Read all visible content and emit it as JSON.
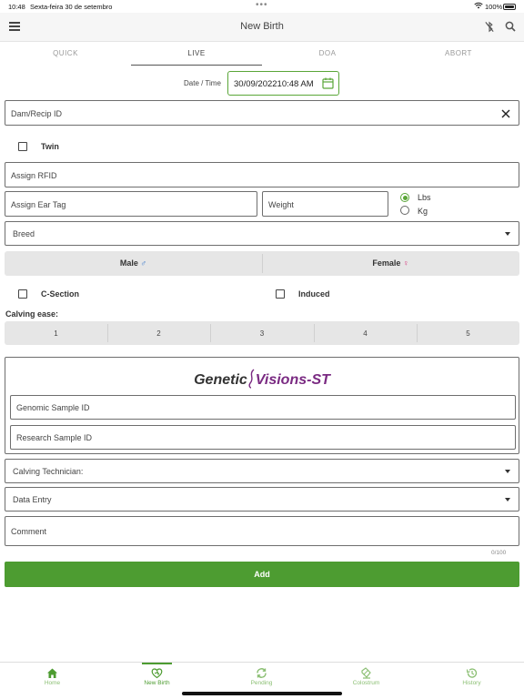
{
  "status_bar": {
    "time": "10:48",
    "date": "Sexta-feira 30 de setembro",
    "dots": "•••",
    "battery": "100%"
  },
  "header": {
    "title": "New Birth",
    "icons": [
      "menu-icon",
      "bluetooth-off-icon",
      "search-icon"
    ]
  },
  "tabs": [
    {
      "label": "QUICK",
      "active": false
    },
    {
      "label": "LIVE",
      "active": true
    },
    {
      "label": "DOA",
      "active": false
    },
    {
      "label": "ABORT",
      "active": false
    }
  ],
  "date_time": {
    "label": "Date / Time",
    "value": "30/09/202210:48 AM"
  },
  "fields": {
    "dam_recip_id": "Dam/Recip ID",
    "assign_rfid": "Assign RFID",
    "assign_ear_tag": "Assign Ear Tag",
    "weight": "Weight",
    "breed": "Breed",
    "genomic_sample_id": "Genomic Sample ID",
    "research_sample_id": "Research Sample ID",
    "calving_technician": "Calving Technician:",
    "data_entry": "Data Entry",
    "comment": "Comment"
  },
  "twin": {
    "label": "Twin",
    "checked": false
  },
  "weight_units": {
    "options": [
      "Lbs",
      "Kg"
    ],
    "selected": "Lbs"
  },
  "sex": {
    "male": "Male",
    "male_symbol": "♂",
    "female": "Female",
    "female_symbol": "♀"
  },
  "options": {
    "c_section": {
      "label": "C-Section",
      "checked": false
    },
    "induced": {
      "label": "Induced",
      "checked": false
    }
  },
  "calving_ease": {
    "label": "Calving ease:",
    "values": [
      "1",
      "2",
      "3",
      "4",
      "5"
    ]
  },
  "genetic_visions": {
    "logo_text_1": "Genetic",
    "logo_text_2": "Visions-ST"
  },
  "comment_counter": "0/100",
  "add_button": "Add",
  "bottom_nav": [
    {
      "label": "Home",
      "icon": "home-icon",
      "active": false
    },
    {
      "label": "New Birth",
      "icon": "new-birth-icon",
      "active": true
    },
    {
      "label": "Pending",
      "icon": "sync-icon",
      "active": false
    },
    {
      "label": "Colostrum",
      "icon": "colostrum-icon",
      "active": false
    },
    {
      "label": "History",
      "icon": "history-icon",
      "active": false
    }
  ],
  "colors": {
    "accent": "#4d9c31",
    "male": "#2a6fc9",
    "female": "#d6337a"
  }
}
